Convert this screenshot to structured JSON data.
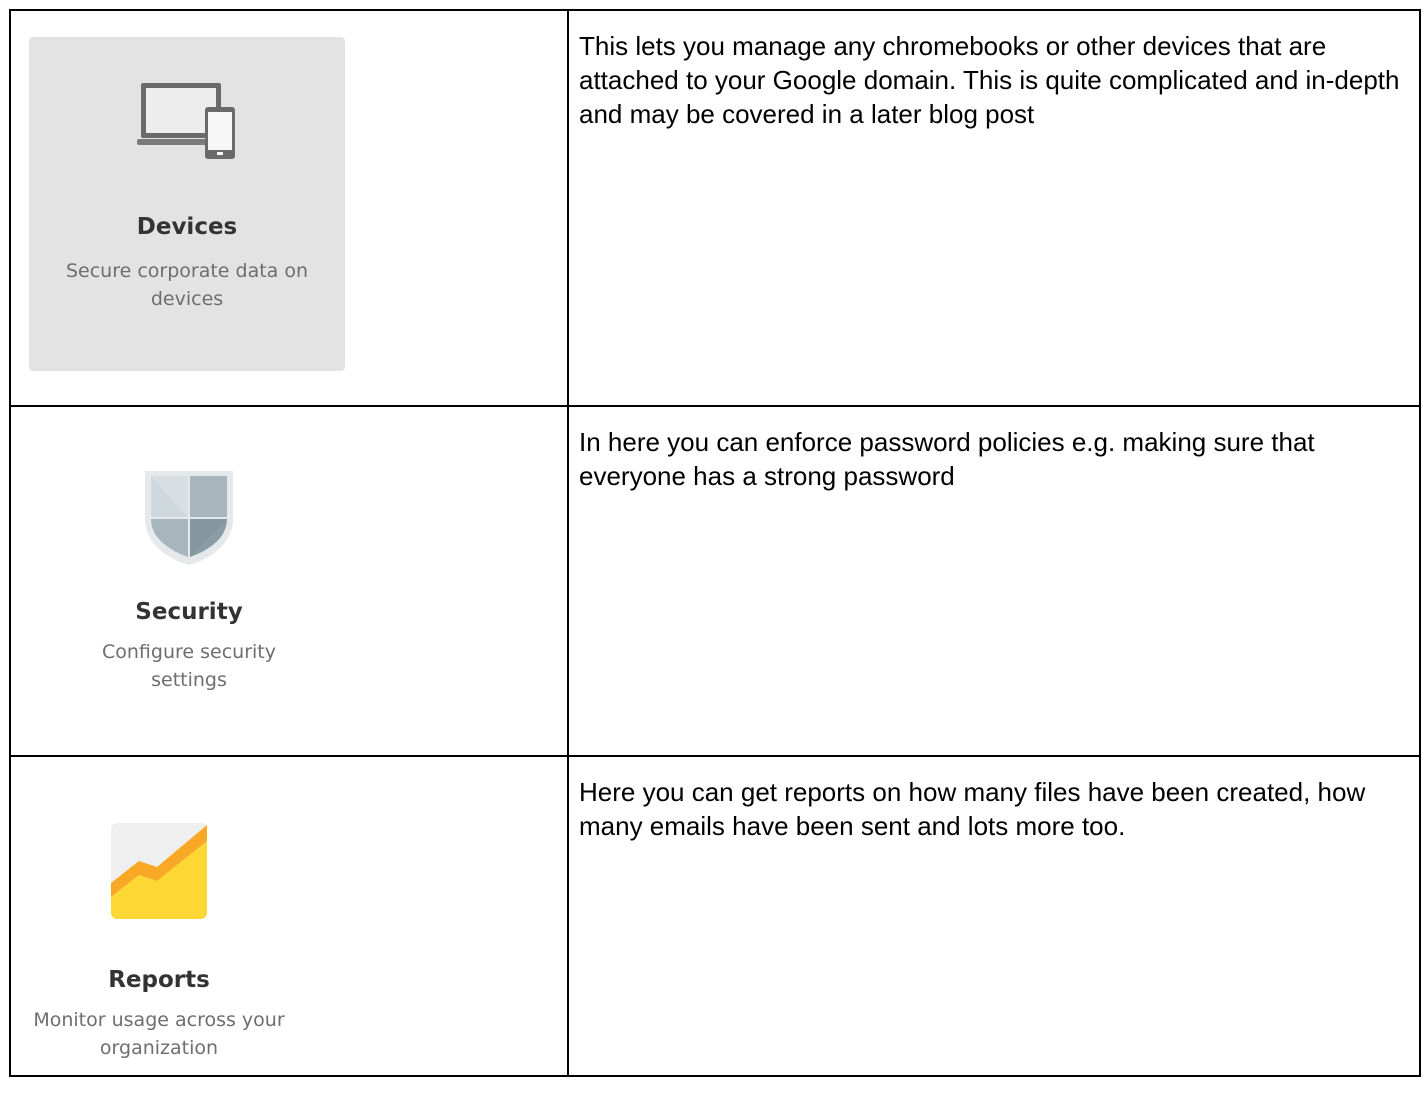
{
  "rows": [
    {
      "tile": {
        "icon": "devices-icon",
        "title": "Devices",
        "description": "Secure corporate data on devices",
        "background": "#e3e3e3"
      },
      "text": "This lets you manage any chromebooks or other devices that are attached to your Google domain. This is quite complicated and in-depth and may be covered in a later blog post"
    },
    {
      "tile": {
        "icon": "security-shield-icon",
        "title": "Security",
        "description": "Configure security settings"
      },
      "text": "In here you can enforce password policies e.g. making sure that everyone has a strong password"
    },
    {
      "tile": {
        "icon": "reports-chart-icon",
        "title": "Reports",
        "description": "Monitor usage across your organization"
      },
      "text": "Here you can get reports on how many files have been created, how many emails have been sent and lots more too."
    }
  ],
  "colors": {
    "border": "#000000",
    "tile_title": "#333333",
    "tile_description": "#6e6e6e",
    "reports_orange": "#f9a825",
    "reports_yellow": "#fdd835",
    "shield_gray": "#b0bec5"
  }
}
